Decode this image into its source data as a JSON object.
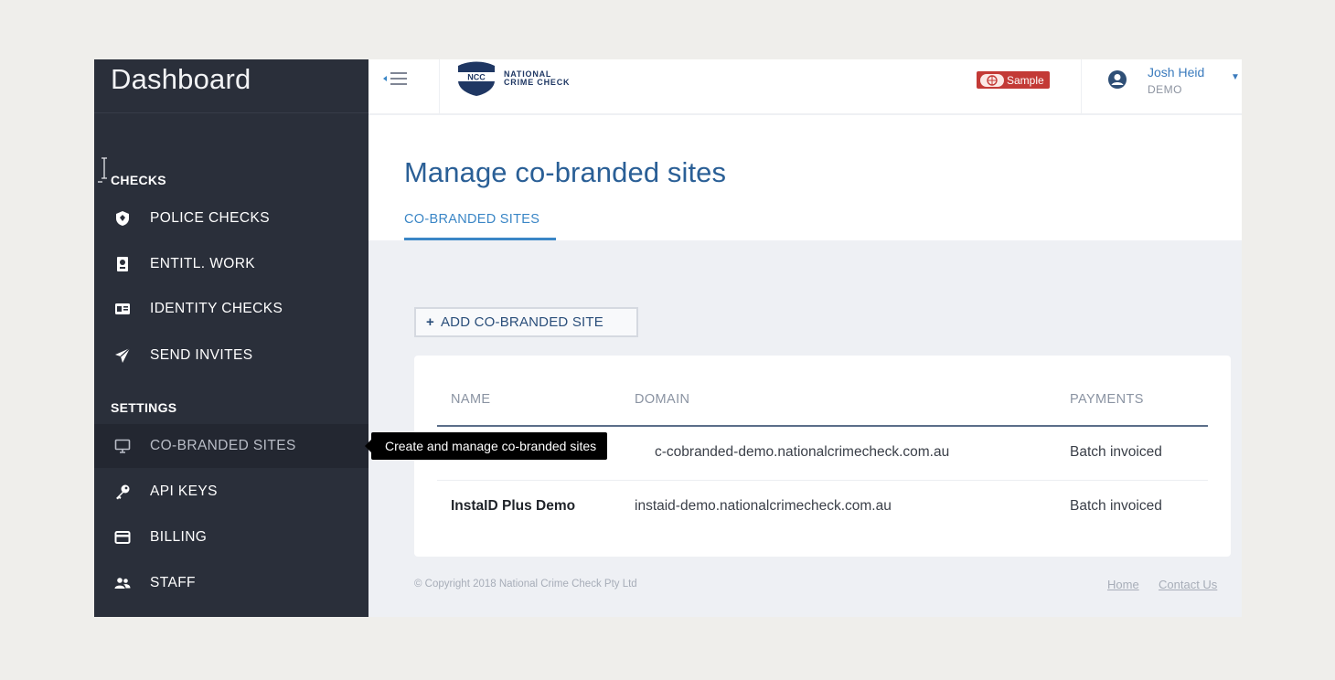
{
  "sidebar": {
    "title": "Dashboard",
    "sections": {
      "checks": "CHECKS",
      "settings": "SETTINGS"
    },
    "items": [
      {
        "label": "POLICE CHECKS",
        "icon": "shield-icon"
      },
      {
        "label": "ENTITL. WORK",
        "icon": "passport-icon"
      },
      {
        "label": "IDENTITY CHECKS",
        "icon": "id-card-icon"
      },
      {
        "label": "SEND INVITES",
        "icon": "paper-plane-icon"
      },
      {
        "label": "CO-BRANDED SITES",
        "icon": "monitor-icon",
        "active": true
      },
      {
        "label": "API KEYS",
        "icon": "key-icon"
      },
      {
        "label": "BILLING",
        "icon": "credit-card-icon"
      },
      {
        "label": "STAFF",
        "icon": "users-icon"
      }
    ]
  },
  "topbar": {
    "logo_mark": "NCC",
    "logo_line1": "NATIONAL",
    "logo_line2": "CRIME CHECK",
    "sample_badge": "Sample",
    "user_name": "Josh Heid",
    "user_role": "DEMO"
  },
  "page": {
    "title": "Manage co-branded sites",
    "tab": "CO-BRANDED SITES",
    "add_button": "ADD CO-BRANDED SITE",
    "add_button_icon": "+"
  },
  "table": {
    "headers": [
      "NAME",
      "DOMAIN",
      "PAYMENTS"
    ],
    "rows": [
      {
        "name": "",
        "domain": "c-cobranded-demo.nationalcrimecheck.com.au",
        "payments": "Batch invoiced"
      },
      {
        "name": "InstaID Plus Demo",
        "domain": "instaid-demo.nationalcrimecheck.com.au",
        "payments": "Batch invoiced"
      }
    ]
  },
  "footer": {
    "copyright": "© Copyright 2018 National Crime Check Pty Ltd",
    "links": [
      "Home",
      "Contact Us"
    ]
  },
  "tooltip": {
    "text": "Create and manage co-branded sites"
  },
  "colors": {
    "sidebar_bg": "#2a2f3a",
    "accent": "#3a86c6",
    "title_blue": "#2a5f96",
    "badge_red": "#c33a36"
  }
}
